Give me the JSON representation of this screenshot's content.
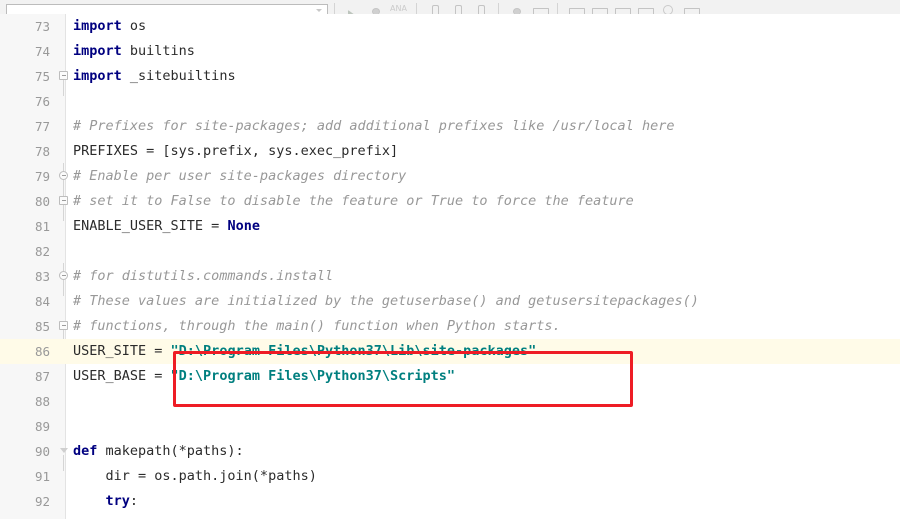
{
  "window": {
    "app": "code-editor",
    "theme_background": "#ffffff",
    "gutter_background": "#f7f7f7",
    "current_line_highlight": "#fffbe8"
  },
  "toolbar": {
    "combo_value": "",
    "items": [
      {
        "name": "run-configurations-combo",
        "label": ""
      },
      {
        "name": "run-button",
        "label": ""
      },
      {
        "name": "debug-button",
        "label": ""
      },
      {
        "name": "coverage-button",
        "label": "ANA"
      },
      {
        "name": "profile-button",
        "label": ""
      },
      {
        "name": "stop-button",
        "label": ""
      },
      {
        "name": "attach-button",
        "label": ""
      },
      {
        "name": "vcs-update-button",
        "label": ""
      },
      {
        "name": "commit-button",
        "label": ""
      },
      {
        "name": "search-everywhere-button",
        "label": ""
      },
      {
        "name": "settings-button",
        "label": ""
      },
      {
        "name": "help-button",
        "label": ""
      }
    ]
  },
  "editor": {
    "language": "python",
    "colors": {
      "keyword": "#000080",
      "comment": "#989898",
      "string": "#007f7f",
      "text": "#2b2b2b",
      "line_number": "#999999",
      "annotation_box": "#ee1c25"
    },
    "first_line": 73,
    "lines": [
      {
        "no": "73",
        "fold": "none",
        "current": false,
        "tokens": [
          {
            "t": "kw",
            "v": "import"
          },
          {
            "t": "plain",
            "v": " os"
          }
        ]
      },
      {
        "no": "74",
        "fold": "none",
        "current": false,
        "tokens": [
          {
            "t": "kw",
            "v": "import"
          },
          {
            "t": "plain",
            "v": " builtins"
          }
        ]
      },
      {
        "no": "75",
        "fold": "collapse-square",
        "current": false,
        "tokens": [
          {
            "t": "kw",
            "v": "import"
          },
          {
            "t": "plain",
            "v": " _sitebuiltins"
          }
        ]
      },
      {
        "no": "76",
        "fold": "none",
        "current": false,
        "tokens": []
      },
      {
        "no": "77",
        "fold": "none",
        "current": false,
        "tokens": [
          {
            "t": "cmt",
            "v": "# Prefixes for site-packages; add additional prefixes like /usr/local here"
          }
        ]
      },
      {
        "no": "78",
        "fold": "none",
        "current": false,
        "tokens": [
          {
            "t": "plain",
            "v": "PREFIXES = [sys.prefix, sys.exec_prefix]"
          }
        ]
      },
      {
        "no": "79",
        "fold": "collapse-round",
        "current": false,
        "tokens": [
          {
            "t": "cmt",
            "v": "# Enable per user site-packages directory"
          }
        ]
      },
      {
        "no": "80",
        "fold": "collapse-square",
        "current": false,
        "tokens": [
          {
            "t": "cmt",
            "v": "# set it to False to disable the feature or True to force the feature"
          }
        ]
      },
      {
        "no": "81",
        "fold": "none",
        "current": false,
        "tokens": [
          {
            "t": "plain",
            "v": "ENABLE_USER_SITE = "
          },
          {
            "t": "kw",
            "v": "None"
          }
        ]
      },
      {
        "no": "82",
        "fold": "none",
        "current": false,
        "tokens": []
      },
      {
        "no": "83",
        "fold": "collapse-round",
        "current": false,
        "tokens": [
          {
            "t": "cmt",
            "v": "# for distutils.commands.install"
          }
        ]
      },
      {
        "no": "84",
        "fold": "none",
        "current": false,
        "tokens": [
          {
            "t": "cmt",
            "v": "# These values are initialized by the getuserbase() and getusersitepackages()"
          }
        ]
      },
      {
        "no": "85",
        "fold": "collapse-square",
        "current": false,
        "tokens": [
          {
            "t": "cmt",
            "v": "# functions, through the main() function when Python starts."
          }
        ]
      },
      {
        "no": "86",
        "fold": "none",
        "current": true,
        "tokens": [
          {
            "t": "plain",
            "v": "USER_SITE = "
          },
          {
            "t": "str",
            "v": "\"D:\\Program Files\\Python37\\Lib\\site-packages\""
          }
        ]
      },
      {
        "no": "87",
        "fold": "none",
        "current": false,
        "tokens": [
          {
            "t": "plain",
            "v": "USER_BASE = "
          },
          {
            "t": "str",
            "v": "\"D:\\Program Files\\Python37\\Scripts\""
          }
        ]
      },
      {
        "no": "88",
        "fold": "none",
        "current": false,
        "tokens": []
      },
      {
        "no": "89",
        "fold": "none",
        "current": false,
        "tokens": []
      },
      {
        "no": "90",
        "fold": "triangle",
        "current": false,
        "tokens": [
          {
            "t": "kw",
            "v": "def"
          },
          {
            "t": "plain",
            "v": " makepath(*paths):"
          }
        ]
      },
      {
        "no": "91",
        "fold": "none",
        "current": false,
        "tokens": [
          {
            "t": "plain",
            "v": "    dir = os.path.join(*paths)"
          }
        ]
      },
      {
        "no": "92",
        "fold": "none",
        "current": false,
        "tokens": [
          {
            "t": "plain",
            "v": "    "
          },
          {
            "t": "kw",
            "v": "try"
          },
          {
            "t": "plain",
            "v": ":"
          }
        ]
      }
    ]
  },
  "annotation": {
    "name": "red-highlight-box",
    "color": "#ee1c25",
    "covers_lines": [
      "86",
      "87"
    ],
    "covers_text": [
      "\"D:\\Program Files\\Python37\\Lib\\site-packages\"",
      "\"D:\\Program Files\\Python37\\Scripts\""
    ]
  }
}
